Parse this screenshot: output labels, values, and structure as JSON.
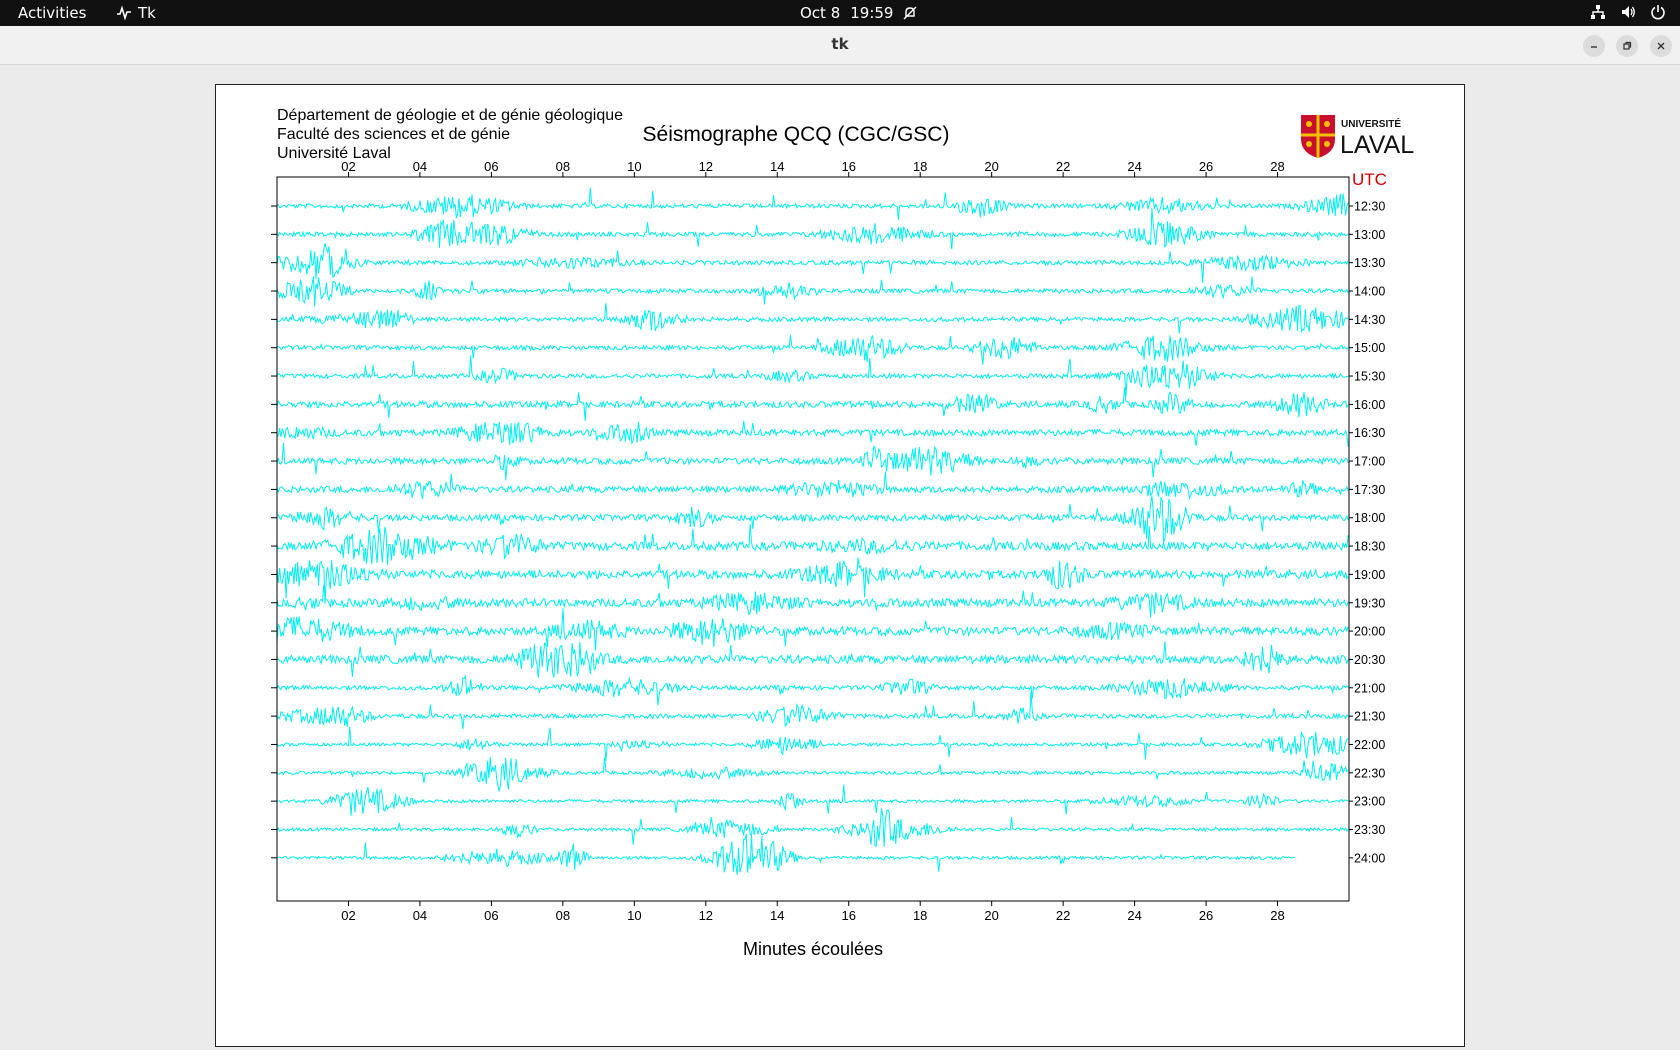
{
  "topbar": {
    "activities": "Activities",
    "app_name": "Tk",
    "date": "Oct 8",
    "time": "19:59"
  },
  "window": {
    "title": "tk"
  },
  "figure": {
    "institution_lines": [
      "Département de géologie et de génie géologique",
      "Faculté des sciences et de génie",
      "Université Laval"
    ],
    "logo": {
      "small": "UNIVERSITÉ",
      "big": "LAVAL"
    }
  },
  "chart_data": {
    "type": "line",
    "title": "Séismographe QCQ (CGC/GSC)",
    "xlabel": "Minutes écoulées",
    "ylabel": "",
    "corner_label": "UTC",
    "xlim": [
      0,
      30
    ],
    "x_ticks": [
      "02",
      "04",
      "06",
      "08",
      "10",
      "12",
      "14",
      "16",
      "18",
      "20",
      "22",
      "24",
      "26",
      "28"
    ],
    "rows": [
      "12:30",
      "13:00",
      "13:30",
      "14:00",
      "14:30",
      "15:00",
      "15:30",
      "16:00",
      "16:30",
      "17:00",
      "17:30",
      "18:00",
      "18:30",
      "19:00",
      "19:30",
      "20:00",
      "20:30",
      "21:00",
      "21:30",
      "22:00",
      "22:30",
      "23:00",
      "23:30",
      "24:00"
    ],
    "last_row_end_minute": 28.5,
    "trace_color": "#00f0f0",
    "grid": false,
    "utc_color": "#d40000"
  }
}
